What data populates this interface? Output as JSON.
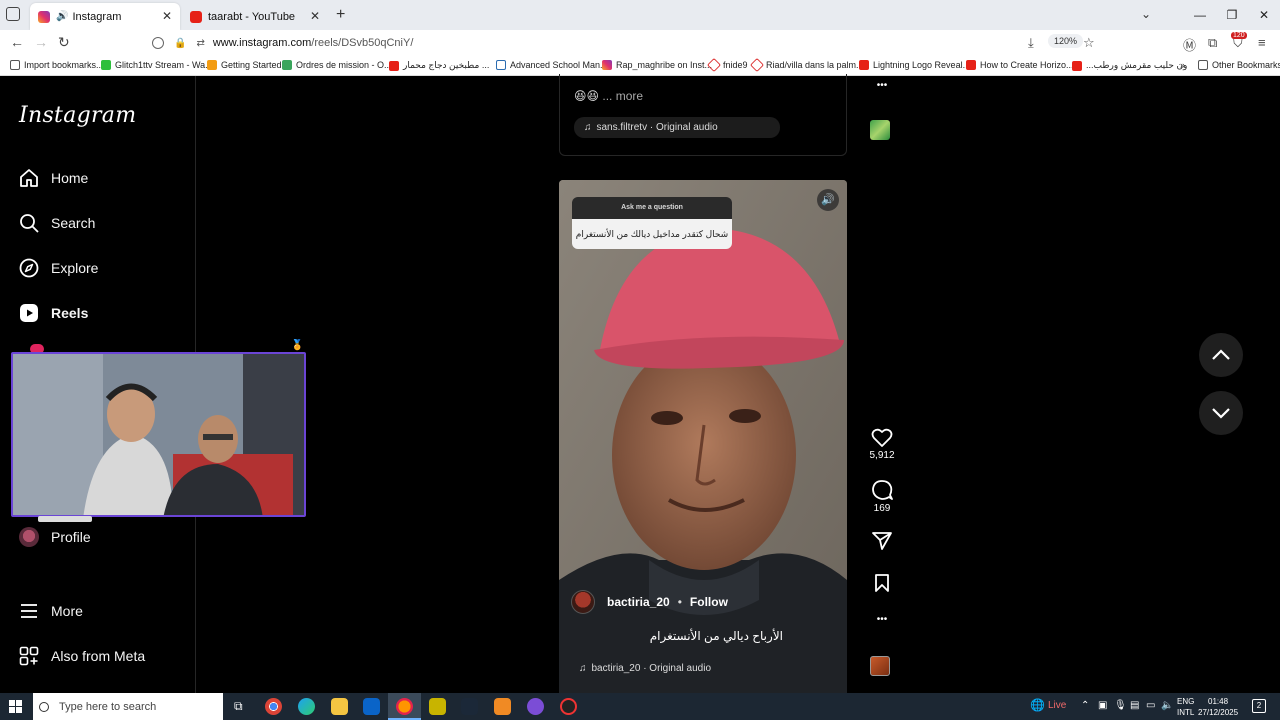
{
  "browser": {
    "tabs": [
      {
        "title": "Instagram",
        "active": true
      },
      {
        "title": "taarabt - YouTube",
        "active": false
      }
    ],
    "url_host": "www.instagram.com",
    "url_path": "/reels/DSvb50qCniY/",
    "zoom": "120%",
    "badge_count": "120",
    "bookmarks": [
      "Import bookmarks...",
      "Glitch1ttv Stream - Wa...",
      "Getting Started",
      "Ordres de mission - O...",
      "مطبخين دجاج محمار ...",
      "Advanced School Man...",
      "Rap_maghribe on Inst...",
      "fnide9",
      "Riad/villa dans la palm...",
      "Lightning Logo Reveal...",
      "How to Create Horizo...",
      "...ون حليب مقرمش ورطب"
    ],
    "other_bookmarks": "Other Bookmarks"
  },
  "sidebar": {
    "logo": "Instagram",
    "items": [
      {
        "label": "Home",
        "icon": "home-icon"
      },
      {
        "label": "Search",
        "icon": "search-icon"
      },
      {
        "label": "Explore",
        "icon": "explore-icon"
      },
      {
        "label": "Reels",
        "icon": "reels-icon"
      },
      {
        "label": "Profile",
        "icon": "avatar"
      },
      {
        "label": "More",
        "icon": "menu-icon"
      },
      {
        "label": "Also from Meta",
        "icon": "meta-icon"
      }
    ]
  },
  "prev_reel": {
    "emoji": "😆😆",
    "more": "... more",
    "audio": "sans.filtretv · Original audio"
  },
  "reel": {
    "sticker_title": "Ask me a question",
    "sticker_text": "شحال كتقدر مداخيل ديالك من الأنستغرام",
    "username": "bactiria_20",
    "dot": "•",
    "follow": "Follow",
    "caption": "الأرباح ديالي من الأنستغرام",
    "audio": "bactiria_20 · Original audio"
  },
  "actions": {
    "likes": "5,912",
    "comments": "169"
  },
  "taskbar": {
    "search_placeholder": "Type here to search",
    "live": "Live",
    "lang_top": "ENG",
    "lang_bottom": "INTL",
    "time": "01:48",
    "date": "27/12/2025",
    "notif_count": "2"
  },
  "colors": {
    "instagram_bg": "#000000",
    "webcam_border": "#6b45d6",
    "helmet": "#d9546a"
  }
}
